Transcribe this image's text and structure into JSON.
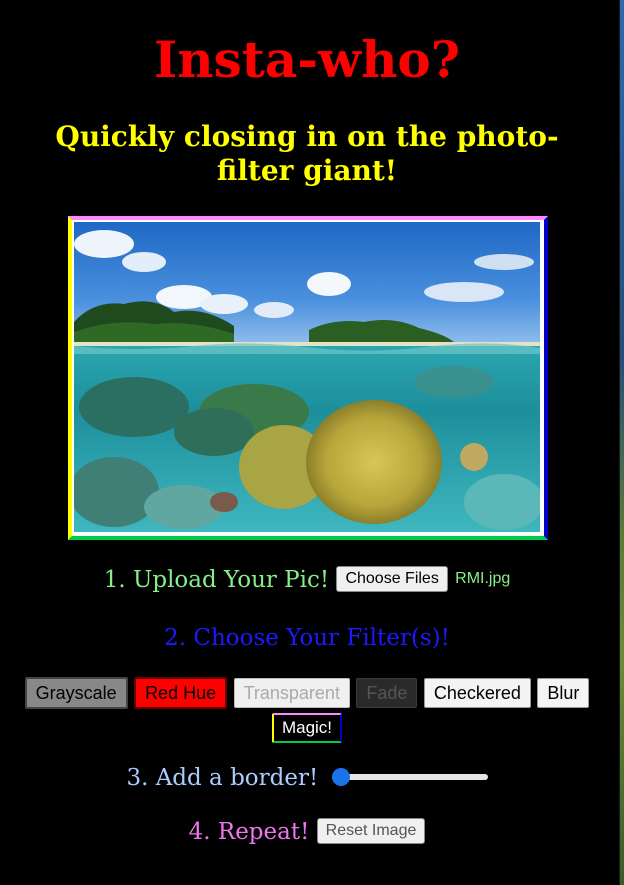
{
  "header": {
    "title": "Insta-who?",
    "subtitle": "Quickly closing in on the photo-filter giant!"
  },
  "photo": {
    "description_icon": "tropical-reef-photo"
  },
  "upload": {
    "label": "1. Upload Your Pic!",
    "button_label": "Choose Files",
    "filename": "RMI.jpg"
  },
  "filters": {
    "label": "2. Choose Your Filter(s)!",
    "buttons": [
      "Grayscale",
      "Red Hue",
      "Transparent",
      "Fade",
      "Checkered",
      "Blur",
      "Magic!"
    ]
  },
  "border": {
    "label": "3. Add a border!",
    "slider_value": 0
  },
  "repeat": {
    "label": "4. Repeat!",
    "reset_label": "Reset Image"
  },
  "colors": {
    "title": "#ff0000",
    "subtitle": "#ffff00",
    "step1": "#88ee88",
    "step2": "#1a1aff",
    "step3": "#aaccff",
    "step4": "#ee77ee",
    "slider_accent": "#1a73e8"
  }
}
